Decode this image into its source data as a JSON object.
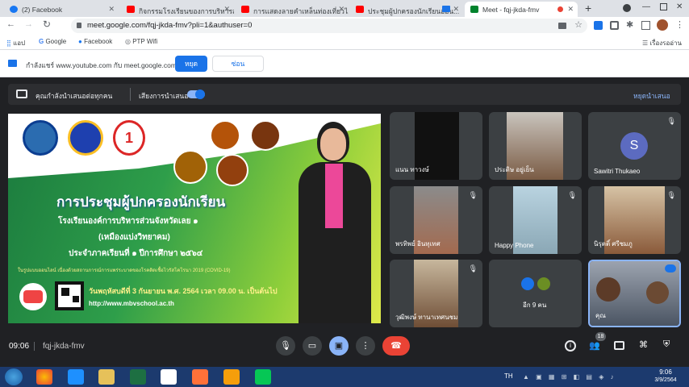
{
  "tabs": [
    "(2) Facebook",
    "กิจกรรมโรงเรียนของการบริหารส่...",
    "การแสดงลายคำเหล็นท่องเที่ยวไ...",
    "ประชุมผู้ปกครองนักเรียนออน...",
    "Meet - fqj-jkda-fmv"
  ],
  "url": "meet.google.com/fqj-jkda-fmv?pli=1&authuser=0",
  "bookmarks": {
    "apps": "แอป",
    "google": "Google",
    "facebook": "Facebook",
    "ptp": "PTP Wifi",
    "reading": "เรื่องรออ่าน"
  },
  "infobar": {
    "text": "กำลังแชร์ www.youtube.com กับ meet.google.com",
    "stop": "หยุด",
    "hide": "ซ่อน"
  },
  "present": {
    "text": "คุณกำลังนำเสนอต่อทุกคน",
    "audio": "เสียงการนำเสนอ",
    "stop": "หยุดนำเสนอ"
  },
  "slide": {
    "title": "การประชุมผู้ปกครองนักเรียน",
    "l1": "โรงเรียนองค์การบริหารส่วนจังหวัดเลย ๑",
    "l2": "(เหมืองแบ่งวิทยาคม)",
    "l3": "ประจำภาคเรียนที่ ๑ ปีการศึกษา ๒๕๖๔",
    "l4": "ในรูปแบบออนไลน์ เนื่องด้วยสถานการณ์การแพร่ระบาดของโรคติดเชื้อไวรัสโคโรนา 2019 (COVID-19)",
    "l5": "วันพฤหัสบดีที่ 3 กันยายน พ.ศ. 2564 เวลา 09.00 น. เป็นต้นไป",
    "url": "http://www.mbvschool.ac.th",
    "badge": "1"
  },
  "participants": [
    {
      "name": "แนน ทาวงษ์"
    },
    {
      "name": "ประดิษ อยู่เย็น"
    },
    {
      "name": "Sawitri Thukaeo",
      "initial": "S"
    },
    {
      "name": "พรทิพย์ อินทุเทศ"
    },
    {
      "name": "Happy Phone"
    },
    {
      "name": "นิรุตติ์ ศรีชมภู"
    },
    {
      "name": "วุฒิพงษ์ ทานาเทศนชม"
    },
    {
      "name": "อีก 9 คน"
    },
    {
      "name": "คุณ"
    }
  ],
  "bottom": {
    "time": "09:06",
    "code": "fqj-jkda-fmv",
    "count": "18"
  },
  "taskbar": {
    "lang": "TH",
    "time": "9:06",
    "date": "3/9/2564"
  }
}
